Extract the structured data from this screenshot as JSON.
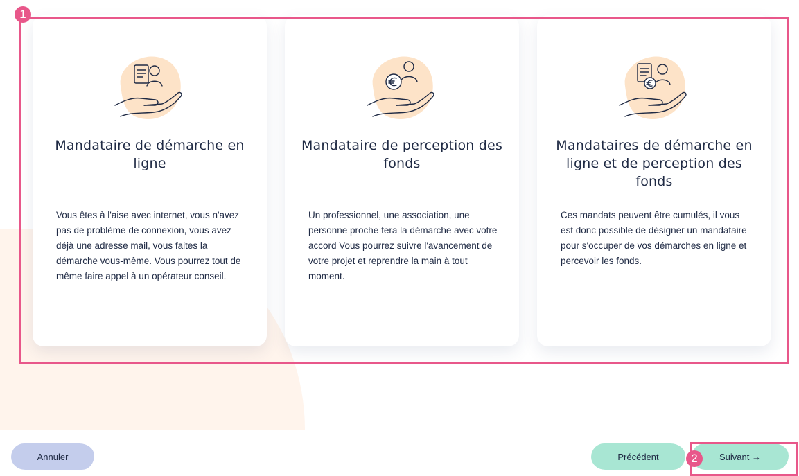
{
  "cards": [
    {
      "title": "Mandataire de démarche en ligne",
      "description": "Vous êtes à l'aise avec internet, vous n'avez pas de problème de connexion, vous avez déjà une adresse mail, vous faites la démarche vous-même. Vous pourrez tout de même faire appel à un opérateur conseil."
    },
    {
      "title": "Mandataire de perception des fonds",
      "description": "Un professionnel, une association, une personne proche fera la démarche avec votre accord Vous pourrez suivre l'avancement de votre projet et reprendre la main à tout moment."
    },
    {
      "title": "Mandataires de démarche en ligne et de perception des fonds",
      "description": "Ces mandats peuvent être cumulés, il vous est donc possible de désigner un mandataire pour s'occuper de vos démarches en ligne et percevoir les fonds."
    }
  ],
  "buttons": {
    "cancel": "Annuler",
    "previous": "Précédent",
    "next": "Suivant →"
  },
  "annotations": {
    "badge_1": "1",
    "badge_2": "2"
  },
  "colors": {
    "annotation": "#e8578a",
    "cancel_button": "#c4cdec",
    "nav_button": "#a8e6d3",
    "illustration_blob": "#fde3c8",
    "background_blob": "#fff4ec"
  },
  "icons": {
    "card_1": "hand-document-person-icon",
    "card_2": "hand-euro-coin-person-icon",
    "card_3": "hand-document-euro-person-icon"
  }
}
